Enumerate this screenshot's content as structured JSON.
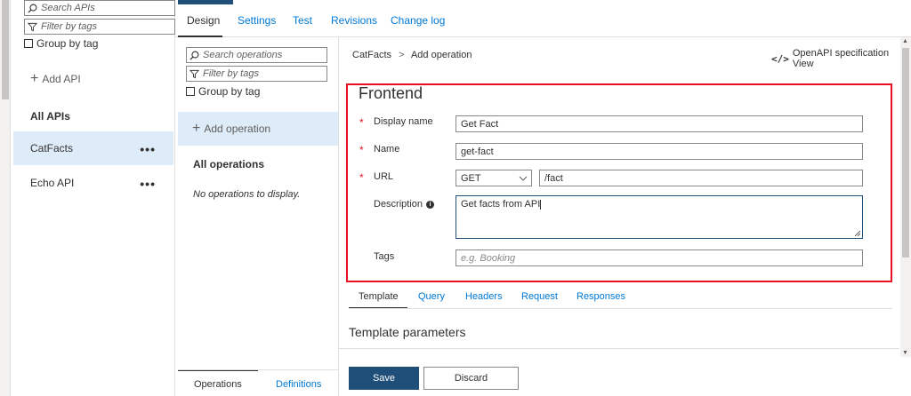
{
  "api_panel": {
    "search_placeholder": "Search APIs",
    "filter_placeholder": "Filter by tags",
    "group_by_tag": "Group by tag",
    "add_api": "Add API",
    "all_apis": "All APIs",
    "apis": [
      {
        "name": "CatFacts",
        "selected": true
      },
      {
        "name": "Echo API",
        "selected": false
      }
    ],
    "more": "•••"
  },
  "top_tabs": [
    "Design",
    "Settings",
    "Test",
    "Revisions",
    "Change log"
  ],
  "operations_panel": {
    "search_placeholder": "Search operations",
    "filter_placeholder": "Filter by tags",
    "group_by_tag": "Group by tag",
    "add_operation": "Add operation",
    "all_operations": "All operations",
    "empty_message": "No operations to display.",
    "bottom_tabs": [
      "Operations",
      "Definitions"
    ]
  },
  "breadcrumb": {
    "api": "CatFacts",
    "separator": ">",
    "page": "Add operation"
  },
  "openapi_view": "OpenAPI specification View",
  "frontend": {
    "title": "Frontend",
    "display_name_label": "Display name",
    "display_name_value": "Get Fact",
    "name_label": "Name",
    "name_value": "get-fact",
    "url_label": "URL",
    "method_value": "GET",
    "url_value": "/fact",
    "description_label": "Description",
    "description_value": "Get facts from API",
    "tags_label": "Tags",
    "tags_placeholder": "e.g. Booking",
    "required_marker": "*"
  },
  "sub_tabs": [
    "Template",
    "Query",
    "Headers",
    "Request",
    "Responses"
  ],
  "template_parameters_title": "Template parameters",
  "actions": {
    "save": "Save",
    "discard": "Discard"
  },
  "colors": {
    "accent": "#0078d4",
    "primary_button": "#1f4e79",
    "highlight_border": "#e81123",
    "selected_bg": "#deecf9"
  }
}
